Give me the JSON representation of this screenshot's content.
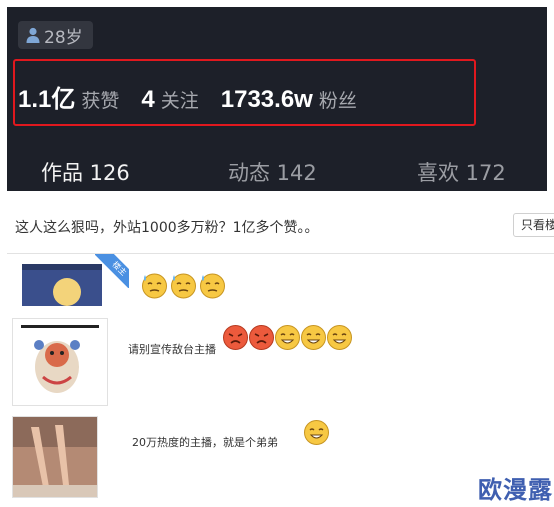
{
  "profile": {
    "age": "28岁",
    "stats": [
      {
        "value": "1.1亿",
        "label": "获赞"
      },
      {
        "value": "4",
        "label": "关注"
      },
      {
        "value": "1733.6w",
        "label": "粉丝"
      }
    ],
    "tabs": [
      {
        "label": "作品 126",
        "active": true
      },
      {
        "label": "动态 142",
        "active": false
      },
      {
        "label": "喜欢 172",
        "active": false
      }
    ],
    "highlight_color": "#e0181e"
  },
  "forum": {
    "post_title": "这人这么狠吗，外站1000多万粉？1亿多个赞。。",
    "view_button": "只看楼主",
    "replies": [
      {
        "badge": "楼主",
        "text": "",
        "emojis": [
          "sweat-emoji",
          "sweat-emoji",
          "sweat-emoji"
        ]
      },
      {
        "text": "请别宣传敌台主播",
        "emojis": [
          "angry-emoji",
          "angry-emoji",
          "grin-emoji",
          "grin-emoji",
          "grin-emoji"
        ]
      },
      {
        "text": "20万热度的主播，就是个弟弟",
        "emojis": [
          "grin-emoji"
        ]
      }
    ]
  },
  "watermark": "欧漫露",
  "colors": {
    "accent_blue": "#4a90e2",
    "panel_dark": "#1d2029",
    "emoji_yellow": "#f7c843",
    "emoji_red": "#ec5a3c"
  }
}
